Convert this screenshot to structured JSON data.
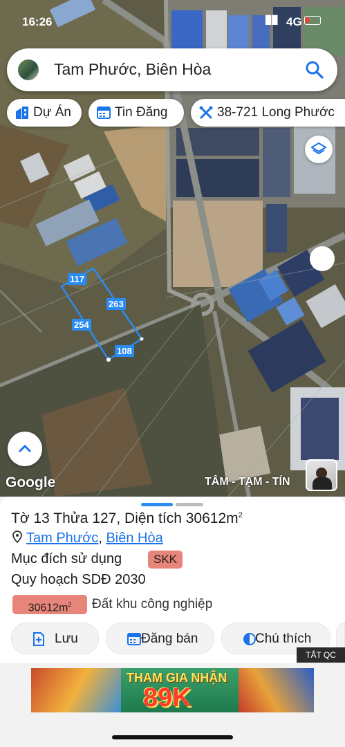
{
  "status_bar": {
    "time": "16:26",
    "signal": "▉▉",
    "network": "4G"
  },
  "search": {
    "title": "Tam Phước, Biên Hòa",
    "search_icon": "search-icon",
    "avatar_icon": "avatar-icon"
  },
  "chips": [
    {
      "label": "Dự Án",
      "icon": "building-icon"
    },
    {
      "label": "Tin Đăng",
      "icon": "calendar-icon"
    },
    {
      "label": "38-721 Long Phước",
      "icon": "tools-icon"
    }
  ],
  "map": {
    "plot_labels": {
      "top": "117",
      "right": "263",
      "left": "254",
      "bottom": "108"
    },
    "google_logo": "Google",
    "brand_text": "TÂM - TẠM - TÍN",
    "accent_color": "#2b8cf0"
  },
  "panel": {
    "title": "Tờ 13 Thửa 127, Diện tích 30612m",
    "title_sup": "2",
    "location_ward": "Tam Phước",
    "location_city": "Biên Hòa",
    "purpose_label": "Mục đích sử dụng",
    "purpose_code": "SKK",
    "planning_label": "Quy hoạch SDĐ 2030",
    "planning_area": "30612m",
    "planning_area_sup": "2",
    "planning_use": "Đất khu công nghiệp",
    "badge_color": "#e8857a"
  },
  "actions": [
    {
      "label": "Lưu",
      "icon": "save-add-icon"
    },
    {
      "label": "Đăng bán",
      "icon": "calendar-icon"
    },
    {
      "label": "Chú thích",
      "icon": "contrast-icon"
    }
  ],
  "ad": {
    "hide_label": "TẮT QC",
    "line1": "THAM GIA NHẬN",
    "line2": "89K"
  }
}
